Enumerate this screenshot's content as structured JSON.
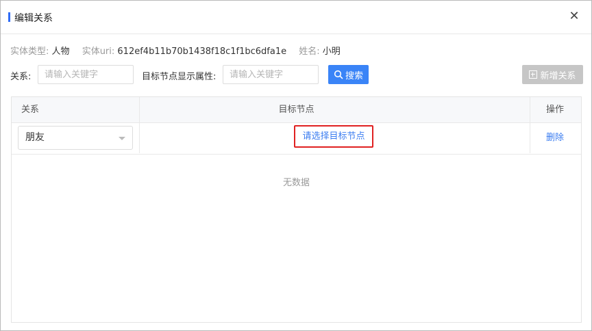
{
  "dialog": {
    "title": "编辑关系",
    "close_glyph": "✕"
  },
  "entity_info": {
    "type_label": "实体类型:",
    "type_value": "人物",
    "uri_label": "实体uri:",
    "uri_value": "612ef4b11b70b1438f18c1f1bc6dfa1e",
    "name_label": "姓名:",
    "name_value": "小明"
  },
  "filters": {
    "relation_label": "关系:",
    "relation_placeholder": "请输入关键字",
    "target_attr_label": "目标节点显示属性:",
    "target_attr_placeholder": "请输入关键字",
    "search_button": "搜索",
    "add_button": "新增关系"
  },
  "table": {
    "columns": [
      "关系",
      "目标节点",
      "操作"
    ],
    "rows": [
      {
        "relation": "朋友",
        "target_action": "请选择目标节点",
        "operation": "删除"
      }
    ],
    "empty_text": "无数据"
  },
  "colors": {
    "accent": "#3a84f7",
    "highlight_border": "#e02020",
    "disabled": "#c6c6c6",
    "link": "#3a7cf0"
  },
  "icons": [
    "close-icon",
    "search-icon",
    "add-box-icon",
    "chevron-down-icon"
  ]
}
